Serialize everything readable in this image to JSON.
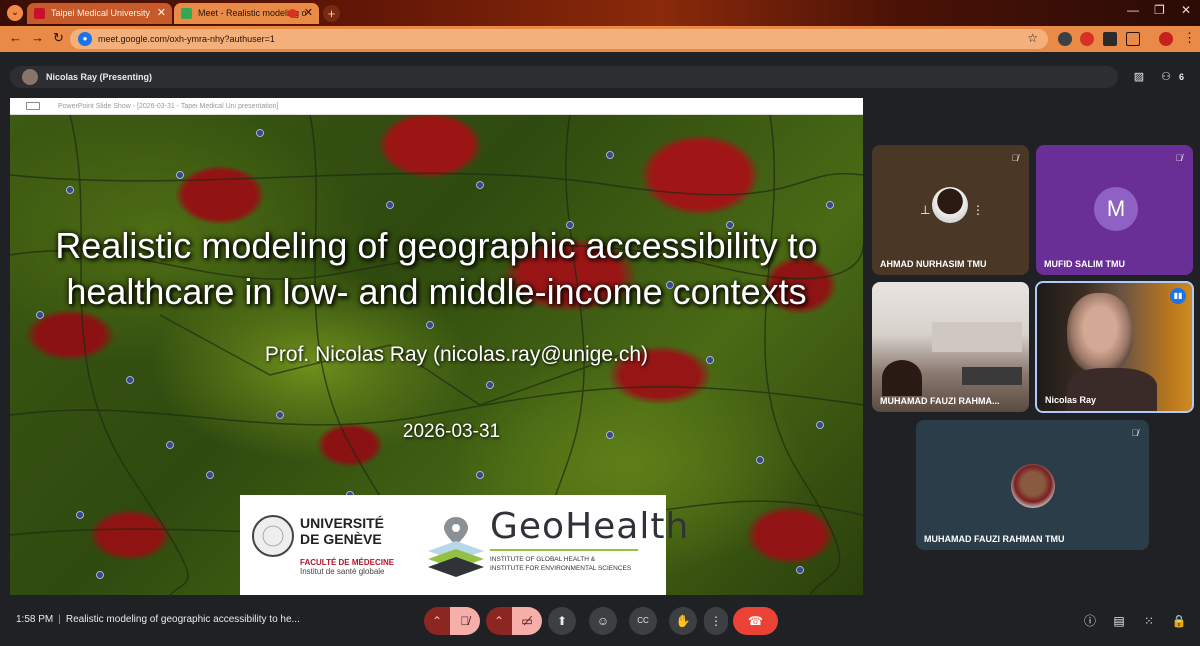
{
  "browser": {
    "tabs": [
      {
        "title": "Taipei Medical University"
      },
      {
        "title": "Meet - Realistic modeling o"
      }
    ],
    "url": "meet.google.com/oxh-ymra-nhy?authuser=1",
    "colors": {
      "accent": "#e98a47",
      "recording": "#d93025"
    }
  },
  "meet": {
    "presenter_label": "Nicolas Ray (Presenting)",
    "people_count": "6",
    "time": "1:58 PM",
    "meeting_title": "Realistic modeling of geographic accessibility to he..."
  },
  "presentation": {
    "window_title": "PowerPoint Slide Show - [2026-03-31 - Tapei Medical Uni presentation]",
    "slide": {
      "title_line1": "Realistic modeling of geographic accessibility to",
      "title_line2": "healthcare in low- and middle-income contexts",
      "author": "Prof. Nicolas Ray (nicolas.ray@unige.ch)",
      "date": "2026-03-31",
      "logos": {
        "unige_line1": "UNIVERSITÉ",
        "unige_line2": "DE GENÈVE",
        "faculty": "FACULTÉ DE MÉDECINE",
        "institute": "Institut de santé globale",
        "geohealth": "GeoHealth",
        "geohealth_sub1": "INSTITUTE OF GLOBAL HEALTH &",
        "geohealth_sub2": "INSTITUTE FOR ENVIRONMENTAL SCIENCES"
      }
    }
  },
  "participants": [
    {
      "name": "AHMAD NURHASIM TMU",
      "muted": true
    },
    {
      "name": "MUFID SALIM TMU",
      "initial": "M",
      "muted": true
    },
    {
      "name": "MUHAMAD FAUZI RAHMA...",
      "muted": false
    },
    {
      "name": "Nicolas Ray",
      "speaking": true
    },
    {
      "name": "MUHAMAD FAUZI RAHMAN TMU",
      "muted": true
    }
  ]
}
